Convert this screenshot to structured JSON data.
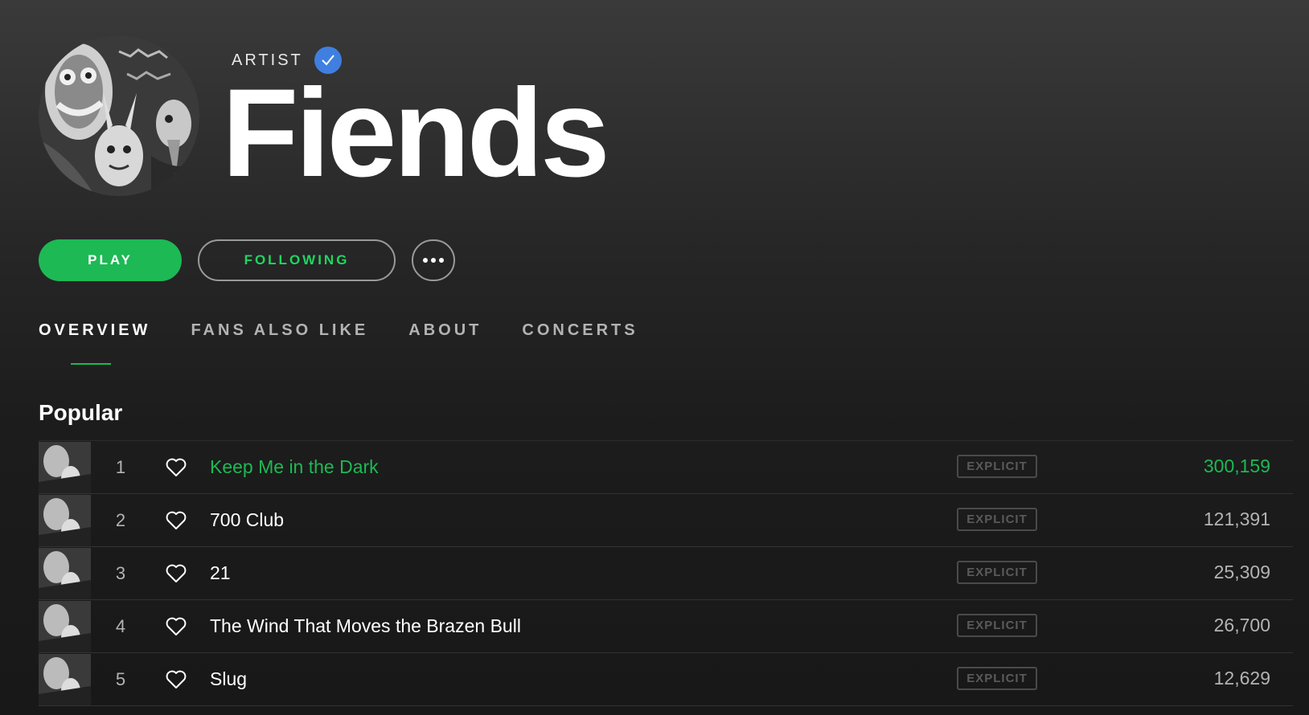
{
  "artist": {
    "label": "ARTIST",
    "name": "Fiends",
    "verified": true,
    "avatar_icon": "artist-image"
  },
  "actions": {
    "play_label": "PLAY",
    "following_label": "FOLLOWING",
    "more_icon": "more-options-icon"
  },
  "tabs": [
    {
      "label": "OVERVIEW",
      "active": true
    },
    {
      "label": "FANS ALSO LIKE",
      "active": false
    },
    {
      "label": "ABOUT",
      "active": false
    },
    {
      "label": "CONCERTS",
      "active": false
    }
  ],
  "popular": {
    "title": "Popular",
    "tracks": [
      {
        "number": "1",
        "title": "Keep Me in the Dark",
        "explicit": "EXPLICIT",
        "plays": "300,159",
        "playing": true
      },
      {
        "number": "2",
        "title": "700 Club",
        "explicit": "EXPLICIT",
        "plays": "121,391",
        "playing": false
      },
      {
        "number": "3",
        "title": "21",
        "explicit": "EXPLICIT",
        "plays": "25,309",
        "playing": false
      },
      {
        "number": "4",
        "title": "The Wind That Moves the Brazen Bull",
        "explicit": "EXPLICIT",
        "plays": "26,700",
        "playing": false
      },
      {
        "number": "5",
        "title": "Slug",
        "explicit": "EXPLICIT",
        "plays": "12,629",
        "playing": false
      }
    ]
  },
  "colors": {
    "accent": "#1db954",
    "verified": "#3f7fe0",
    "background": "#181818"
  }
}
